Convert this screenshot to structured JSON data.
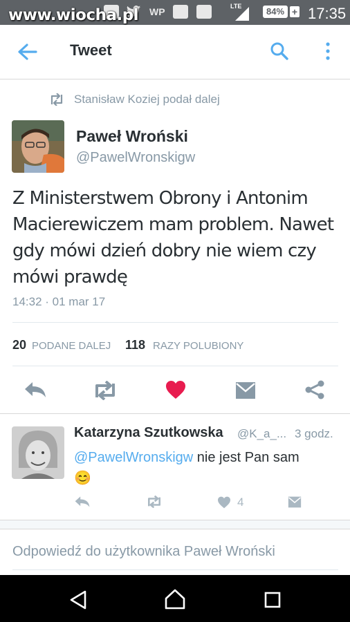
{
  "status_bar": {
    "watermark": "www.wiocha.pl",
    "network": "LTE",
    "battery": "84%",
    "time": "17:35"
  },
  "toolbar": {
    "title": "Tweet",
    "back_icon": "arrow-left-icon",
    "search_icon": "search-icon",
    "menu_icon": "more-vertical-icon"
  },
  "tweet": {
    "retweeted_by": "Stanisław Koziej podał dalej",
    "author_name": "Paweł Wroński",
    "author_handle": "@PawelWronskigw",
    "text": "Z Ministerstwem Obrony i Antonim Macierewiczem mam problem. Nawet gdy mówi dzień dobry nie wiem czy mówi prawdę",
    "timestamp": "14:32 · 01 mar 17",
    "retweets_count": "20",
    "retweets_label": "PODANE DALEJ",
    "likes_count": "118",
    "likes_label": "RAZY POLUBIONY",
    "like_color": "#e81c4f"
  },
  "reply": {
    "author_name": "Katarzyna Szutkowska",
    "author_handle": "@K_a_...",
    "time": "3 godz.",
    "mention": "@PawelWronskigw",
    "text": " nie jest Pan sam",
    "emoji": "😊",
    "like_count": "4"
  },
  "compose": {
    "placeholder": "Odpowiedź do użytkownika Paweł Wroński"
  },
  "colors": {
    "accent": "#55acee",
    "icon_gray": "#8899a6"
  }
}
